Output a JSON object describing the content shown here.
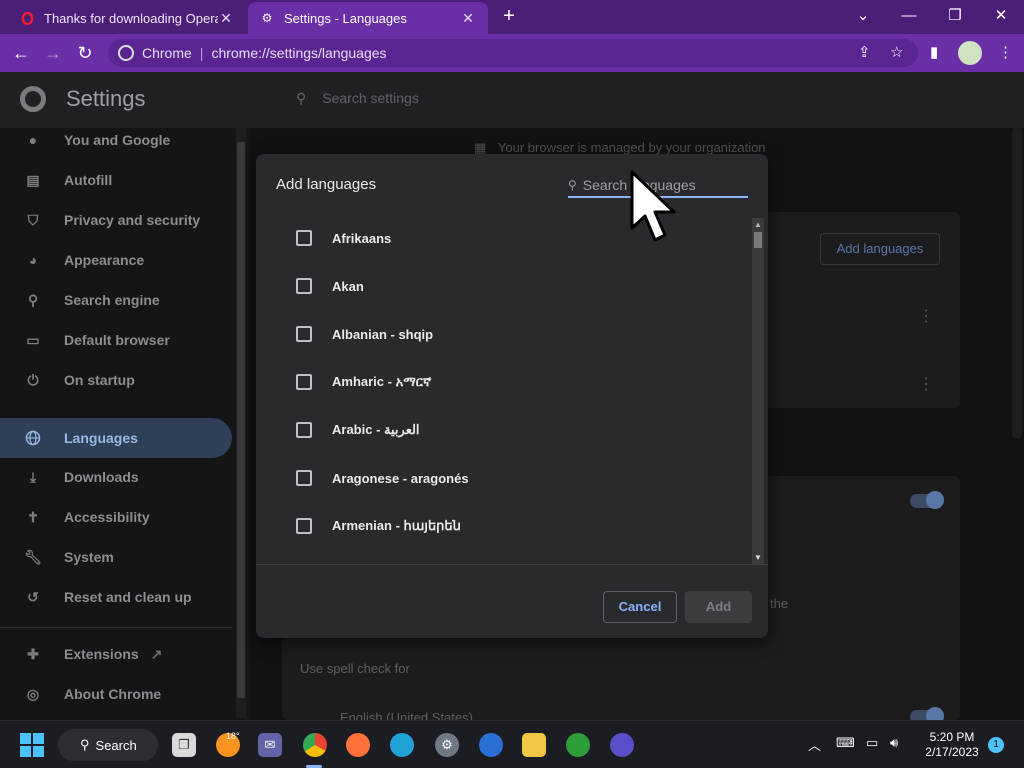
{
  "browser": {
    "tabs": [
      {
        "title": "Thanks for downloading Opera",
        "icon": "opera-icon",
        "active": false
      },
      {
        "title": "Settings - Languages",
        "icon": "gear-icon",
        "active": true
      }
    ],
    "new_tab_label": "+",
    "omnibox": {
      "chip": "Chrome",
      "separator": "|",
      "url": "chrome://settings/languages"
    }
  },
  "settings": {
    "title": "Settings",
    "search_placeholder": "Search settings",
    "sidebar": [
      {
        "label": "You and Google",
        "icon": "person-icon"
      },
      {
        "label": "Autofill",
        "icon": "clipboard-icon"
      },
      {
        "label": "Privacy and security",
        "icon": "shield-icon"
      },
      {
        "label": "Appearance",
        "icon": "palette-icon"
      },
      {
        "label": "Search engine",
        "icon": "search-icon"
      },
      {
        "label": "Default browser",
        "icon": "browser-icon"
      },
      {
        "label": "On startup",
        "icon": "power-icon"
      },
      {
        "label": "Languages",
        "icon": "globe-icon",
        "active": true
      },
      {
        "label": "Downloads",
        "icon": "download-icon"
      },
      {
        "label": "Accessibility",
        "icon": "accessibility-icon"
      },
      {
        "label": "System",
        "icon": "wrench-icon"
      },
      {
        "label": "Reset and clean up",
        "icon": "reset-icon"
      }
    ],
    "sidebar_bottom": [
      {
        "label": "Extensions",
        "icon": "puzzle-icon"
      },
      {
        "label": "About Chrome",
        "icon": "chrome-icon"
      }
    ],
    "managed_notice": "Your browser is managed by your organization",
    "add_languages_button": "Add languages",
    "background_text": {
      "partial_the": "the",
      "spell_check_for": "Use spell check for",
      "english_us": "English (United States)"
    }
  },
  "dialog": {
    "title": "Add languages",
    "search_placeholder": "Search languages",
    "languages": [
      "Afrikaans",
      "Akan",
      "Albanian - shqip",
      "Amharic - አማርኛ",
      "Arabic - العربية",
      "Aragonese - aragonés",
      "Armenian - հայերեն"
    ],
    "cancel_label": "Cancel",
    "add_label": "Add"
  },
  "taskbar": {
    "search_label": "Search",
    "weather_temp": "18°",
    "time": "5:20 PM",
    "date": "2/17/2023",
    "notification_count": "1"
  },
  "colors": {
    "tab_bar": "#4b1f78",
    "toolbar": "#6a2fa6",
    "accent": "#8ab4f8",
    "dialog_bg": "#292a2d"
  }
}
